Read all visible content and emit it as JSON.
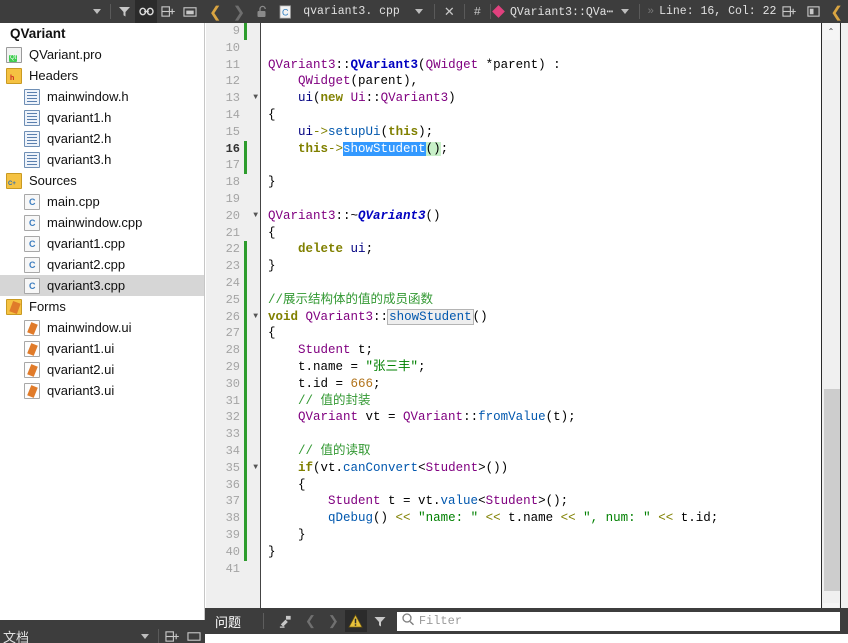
{
  "toolbar": {
    "icons": {
      "dropdown": "chevron-down-icon",
      "filter": "filter-icon",
      "link": "link-icon",
      "split": "split-add-icon",
      "panel": "panel-icon",
      "back": "back-arrow-icon",
      "forward": "forward-arrow-icon",
      "lock": "lock-open-icon",
      "file": "cpp-file-icon",
      "close": "close-icon",
      "hash": "hash-icon"
    },
    "back_glyph": "❮",
    "forward_glyph": "❯",
    "lock_glyph": "🔓",
    "document_name": "qvariant3. cpp",
    "close_glyph": "✕",
    "hash_glyph": "#",
    "symbol_label": "QVariant3::QVa⋯",
    "chevron_glyph": "»",
    "line_col": "Line: 16, Col: 22",
    "split_glyph": "⌸+",
    "panel_glyph": "▣",
    "right_arrow_glyph": "❮"
  },
  "sidebar": {
    "project_name": "QVariant",
    "items": [
      {
        "label": "QVariant.pro",
        "icon": "qt-project-file-icon",
        "icon_class": "ic-pro",
        "indent": 0,
        "selected": false
      },
      {
        "label": "Headers",
        "icon": "headers-folder-icon",
        "icon_class": "ic-folder-h",
        "indent": 0,
        "selected": false
      },
      {
        "label": "mainwindow.h",
        "icon": "header-file-icon",
        "icon_class": "ic-h",
        "indent": 1,
        "selected": false
      },
      {
        "label": "qvariant1.h",
        "icon": "header-file-icon",
        "icon_class": "ic-h",
        "indent": 1,
        "selected": false
      },
      {
        "label": "qvariant2.h",
        "icon": "header-file-icon",
        "icon_class": "ic-h",
        "indent": 1,
        "selected": false
      },
      {
        "label": "qvariant3.h",
        "icon": "header-file-icon",
        "icon_class": "ic-h",
        "indent": 1,
        "selected": false
      },
      {
        "label": "Sources",
        "icon": "sources-folder-icon",
        "icon_class": "ic-folder-c",
        "indent": 0,
        "selected": false
      },
      {
        "label": "main.cpp",
        "icon": "cpp-file-icon",
        "icon_class": "ic-cpp",
        "indent": 1,
        "selected": false
      },
      {
        "label": "mainwindow.cpp",
        "icon": "cpp-file-icon",
        "icon_class": "ic-cpp",
        "indent": 1,
        "selected": false
      },
      {
        "label": "qvariant1.cpp",
        "icon": "cpp-file-icon",
        "icon_class": "ic-cpp",
        "indent": 1,
        "selected": false
      },
      {
        "label": "qvariant2.cpp",
        "icon": "cpp-file-icon",
        "icon_class": "ic-cpp",
        "indent": 1,
        "selected": false
      },
      {
        "label": "qvariant3.cpp",
        "icon": "cpp-file-icon",
        "icon_class": "ic-cpp",
        "indent": 1,
        "selected": true
      },
      {
        "label": "Forms",
        "icon": "forms-folder-icon",
        "icon_class": "ic-folder-f",
        "indent": 0,
        "selected": false
      },
      {
        "label": "mainwindow.ui",
        "icon": "ui-file-icon",
        "icon_class": "ic-ui",
        "indent": 1,
        "selected": false
      },
      {
        "label": "qvariant1.ui",
        "icon": "ui-file-icon",
        "icon_class": "ic-ui",
        "indent": 1,
        "selected": false
      },
      {
        "label": "qvariant2.ui",
        "icon": "ui-file-icon",
        "icon_class": "ic-ui",
        "indent": 1,
        "selected": false
      },
      {
        "label": "qvariant3.ui",
        "icon": "ui-file-icon",
        "icon_class": "ic-ui",
        "indent": 1,
        "selected": false
      }
    ]
  },
  "editor": {
    "current_line": 16,
    "first_line": 9,
    "last_line": 41,
    "lines": [
      {
        "n": 9,
        "change": true,
        "fold": false,
        "tokens": []
      },
      {
        "n": 10,
        "change": false,
        "fold": false,
        "tokens": []
      },
      {
        "n": 11,
        "change": false,
        "fold": false,
        "tokens": [
          {
            "t": "QVariant3",
            "c": "s-type"
          },
          {
            "t": "::",
            "c": "s-op"
          },
          {
            "t": "QVariant3",
            "c": "s-funcb"
          },
          {
            "t": "(",
            "c": "s-op"
          },
          {
            "t": "QWidget",
            "c": "s-type"
          },
          {
            "t": " *",
            "c": "s-op"
          },
          {
            "t": "parent",
            "c": "s-plain"
          },
          {
            "t": ") :",
            "c": "s-op"
          }
        ]
      },
      {
        "n": 12,
        "change": false,
        "fold": false,
        "tokens": [
          {
            "t": "    ",
            "c": "s-plain"
          },
          {
            "t": "QWidget",
            "c": "s-type"
          },
          {
            "t": "(",
            "c": "s-op"
          },
          {
            "t": "parent",
            "c": "s-plain"
          },
          {
            "t": "),",
            "c": "s-op"
          }
        ]
      },
      {
        "n": 13,
        "change": false,
        "fold": true,
        "tokens": [
          {
            "t": "    ",
            "c": "s-plain"
          },
          {
            "t": "ui",
            "c": "s-var"
          },
          {
            "t": "(",
            "c": "s-op"
          },
          {
            "t": "new",
            "c": "s-kw"
          },
          {
            "t": " ",
            "c": "s-plain"
          },
          {
            "t": "Ui",
            "c": "s-type"
          },
          {
            "t": "::",
            "c": "s-op"
          },
          {
            "t": "QVariant3",
            "c": "s-type"
          },
          {
            "t": ")",
            "c": "s-op"
          }
        ]
      },
      {
        "n": 14,
        "change": false,
        "fold": false,
        "tokens": [
          {
            "t": "{",
            "c": "s-op"
          }
        ]
      },
      {
        "n": 15,
        "change": false,
        "fold": false,
        "tokens": [
          {
            "t": "    ",
            "c": "s-plain"
          },
          {
            "t": "ui",
            "c": "s-var"
          },
          {
            "t": "->",
            "c": "s-kw2"
          },
          {
            "t": "setupUi",
            "c": "s-func"
          },
          {
            "t": "(",
            "c": "s-op"
          },
          {
            "t": "this",
            "c": "s-kw"
          },
          {
            "t": ");",
            "c": "s-op"
          }
        ]
      },
      {
        "n": 16,
        "change": true,
        "fold": false,
        "tokens": [
          {
            "t": "    ",
            "c": "s-plain"
          },
          {
            "t": "this",
            "c": "s-kw"
          },
          {
            "t": "->",
            "c": "s-kw2"
          },
          {
            "t": "showStudent",
            "c": "sel-blue"
          },
          {
            "t": "()",
            "c": "hl-green s-op"
          },
          {
            "t": ";",
            "c": "s-op"
          }
        ]
      },
      {
        "n": 17,
        "change": true,
        "fold": false,
        "tokens": []
      },
      {
        "n": 18,
        "change": false,
        "fold": false,
        "tokens": [
          {
            "t": "}",
            "c": "s-op"
          }
        ]
      },
      {
        "n": 19,
        "change": false,
        "fold": false,
        "tokens": []
      },
      {
        "n": 20,
        "change": false,
        "fold": true,
        "tokens": [
          {
            "t": "QVariant3",
            "c": "s-type"
          },
          {
            "t": "::~",
            "c": "s-op"
          },
          {
            "t": "QVariant3",
            "c": "s-typei"
          },
          {
            "t": "()",
            "c": "s-op"
          }
        ]
      },
      {
        "n": 21,
        "change": false,
        "fold": false,
        "tokens": [
          {
            "t": "{",
            "c": "s-op"
          }
        ]
      },
      {
        "n": 22,
        "change": true,
        "fold": false,
        "tokens": [
          {
            "t": "    ",
            "c": "s-plain"
          },
          {
            "t": "delete",
            "c": "s-kw"
          },
          {
            "t": " ",
            "c": "s-plain"
          },
          {
            "t": "ui",
            "c": "s-var"
          },
          {
            "t": ";",
            "c": "s-op"
          }
        ]
      },
      {
        "n": 23,
        "change": true,
        "fold": false,
        "tokens": [
          {
            "t": "}",
            "c": "s-op"
          }
        ]
      },
      {
        "n": 24,
        "change": true,
        "fold": false,
        "tokens": []
      },
      {
        "n": 25,
        "change": true,
        "fold": false,
        "tokens": [
          {
            "t": "//展示结构体的值的成员函数",
            "c": "s-com"
          }
        ]
      },
      {
        "n": 26,
        "change": true,
        "fold": true,
        "tokens": [
          {
            "t": "void",
            "c": "s-kw"
          },
          {
            "t": " ",
            "c": "s-plain"
          },
          {
            "t": "QVariant3",
            "c": "s-type"
          },
          {
            "t": "::",
            "c": "s-op"
          },
          {
            "t": "showStudent",
            "c": "occ-box s-func"
          },
          {
            "t": "()",
            "c": "s-op"
          }
        ]
      },
      {
        "n": 27,
        "change": true,
        "fold": false,
        "tokens": [
          {
            "t": "{",
            "c": "s-op"
          }
        ]
      },
      {
        "n": 28,
        "change": true,
        "fold": false,
        "tokens": [
          {
            "t": "    ",
            "c": "s-plain"
          },
          {
            "t": "Student",
            "c": "s-type"
          },
          {
            "t": " t;",
            "c": "s-op"
          }
        ]
      },
      {
        "n": 29,
        "change": true,
        "fold": false,
        "tokens": [
          {
            "t": "    ",
            "c": "s-plain"
          },
          {
            "t": "t.name = ",
            "c": "s-op"
          },
          {
            "t": "\"张三丰\"",
            "c": "s-str"
          },
          {
            "t": ";",
            "c": "s-op"
          }
        ]
      },
      {
        "n": 30,
        "change": true,
        "fold": false,
        "tokens": [
          {
            "t": "    ",
            "c": "s-plain"
          },
          {
            "t": "t.id = ",
            "c": "s-op"
          },
          {
            "t": "666",
            "c": "s-num"
          },
          {
            "t": ";",
            "c": "s-op"
          }
        ]
      },
      {
        "n": 31,
        "change": true,
        "fold": false,
        "tokens": [
          {
            "t": "    ",
            "c": "s-plain"
          },
          {
            "t": "// 值的封装",
            "c": "s-com"
          }
        ]
      },
      {
        "n": 32,
        "change": true,
        "fold": false,
        "tokens": [
          {
            "t": "    ",
            "c": "s-plain"
          },
          {
            "t": "QVariant",
            "c": "s-type"
          },
          {
            "t": " vt = ",
            "c": "s-op"
          },
          {
            "t": "QVariant",
            "c": "s-type"
          },
          {
            "t": "::",
            "c": "s-op"
          },
          {
            "t": "fromValue",
            "c": "s-func"
          },
          {
            "t": "(t);",
            "c": "s-op"
          }
        ]
      },
      {
        "n": 33,
        "change": true,
        "fold": false,
        "tokens": []
      },
      {
        "n": 34,
        "change": true,
        "fold": false,
        "tokens": [
          {
            "t": "    ",
            "c": "s-plain"
          },
          {
            "t": "// 值的读取",
            "c": "s-com"
          }
        ]
      },
      {
        "n": 35,
        "change": true,
        "fold": true,
        "tokens": [
          {
            "t": "    ",
            "c": "s-plain"
          },
          {
            "t": "if",
            "c": "s-kw"
          },
          {
            "t": "(vt.",
            "c": "s-op"
          },
          {
            "t": "canConvert",
            "c": "s-func"
          },
          {
            "t": "<",
            "c": "s-op"
          },
          {
            "t": "Student",
            "c": "s-type"
          },
          {
            "t": ">())",
            "c": "s-op"
          }
        ]
      },
      {
        "n": 36,
        "change": true,
        "fold": false,
        "tokens": [
          {
            "t": "    {",
            "c": "s-op"
          }
        ]
      },
      {
        "n": 37,
        "change": true,
        "fold": false,
        "tokens": [
          {
            "t": "        ",
            "c": "s-plain"
          },
          {
            "t": "Student",
            "c": "s-type"
          },
          {
            "t": " t = vt.",
            "c": "s-op"
          },
          {
            "t": "value",
            "c": "s-func"
          },
          {
            "t": "<",
            "c": "s-op"
          },
          {
            "t": "Student",
            "c": "s-type"
          },
          {
            "t": ">();",
            "c": "s-op"
          }
        ]
      },
      {
        "n": 38,
        "change": true,
        "fold": false,
        "tokens": [
          {
            "t": "        ",
            "c": "s-plain"
          },
          {
            "t": "qDebug",
            "c": "s-func"
          },
          {
            "t": "() ",
            "c": "s-op"
          },
          {
            "t": "<<",
            "c": "s-kw2"
          },
          {
            "t": " ",
            "c": "s-plain"
          },
          {
            "t": "\"name: \"",
            "c": "s-str"
          },
          {
            "t": " ",
            "c": "s-plain"
          },
          {
            "t": "<<",
            "c": "s-kw2"
          },
          {
            "t": " t.name ",
            "c": "s-op"
          },
          {
            "t": "<<",
            "c": "s-kw2"
          },
          {
            "t": " ",
            "c": "s-plain"
          },
          {
            "t": "\", num: \"",
            "c": "s-str"
          },
          {
            "t": " ",
            "c": "s-plain"
          },
          {
            "t": "<<",
            "c": "s-kw2"
          },
          {
            "t": " t.id;",
            "c": "s-op"
          }
        ]
      },
      {
        "n": 39,
        "change": true,
        "fold": false,
        "tokens": [
          {
            "t": "    }",
            "c": "s-op"
          }
        ]
      },
      {
        "n": 40,
        "change": true,
        "fold": false,
        "tokens": [
          {
            "t": "}",
            "c": "s-op"
          }
        ]
      },
      {
        "n": 41,
        "change": false,
        "fold": false,
        "tokens": []
      }
    ],
    "scroll": {
      "up_glyph": "⌃",
      "down_glyph": "⌄",
      "thumb_top_pct": 62,
      "thumb_height_pct": 36
    }
  },
  "bottom_bar": {
    "panel_label": "问题",
    "clear_glyph": "✇",
    "prev_glyph": "❮",
    "next_glyph": "❯",
    "warning_glyph": "⚠",
    "filter_glyph": "ᑕ",
    "search_glyph": "⌕",
    "filter_placeholder": "Filter"
  },
  "bottom_left": {
    "label": "文档",
    "caret_glyph": "▾",
    "split_glyph": "⌸+",
    "panel_glyph": "▭"
  },
  "colors": {
    "toolbar_bg": "#3d3d3d",
    "toolbar_active": "#2b2b2b",
    "accent_yellow": "#d9a441",
    "symbol_pink": "#e0417e",
    "selection_blue": "#3399ff",
    "highlight_green": "#c8f0c8",
    "gutter_bg": "#efefef",
    "change_marker": "#2d9c2d",
    "sidebar_selected": "#d6d6d6",
    "warning_yellow": "#e8c23a"
  }
}
